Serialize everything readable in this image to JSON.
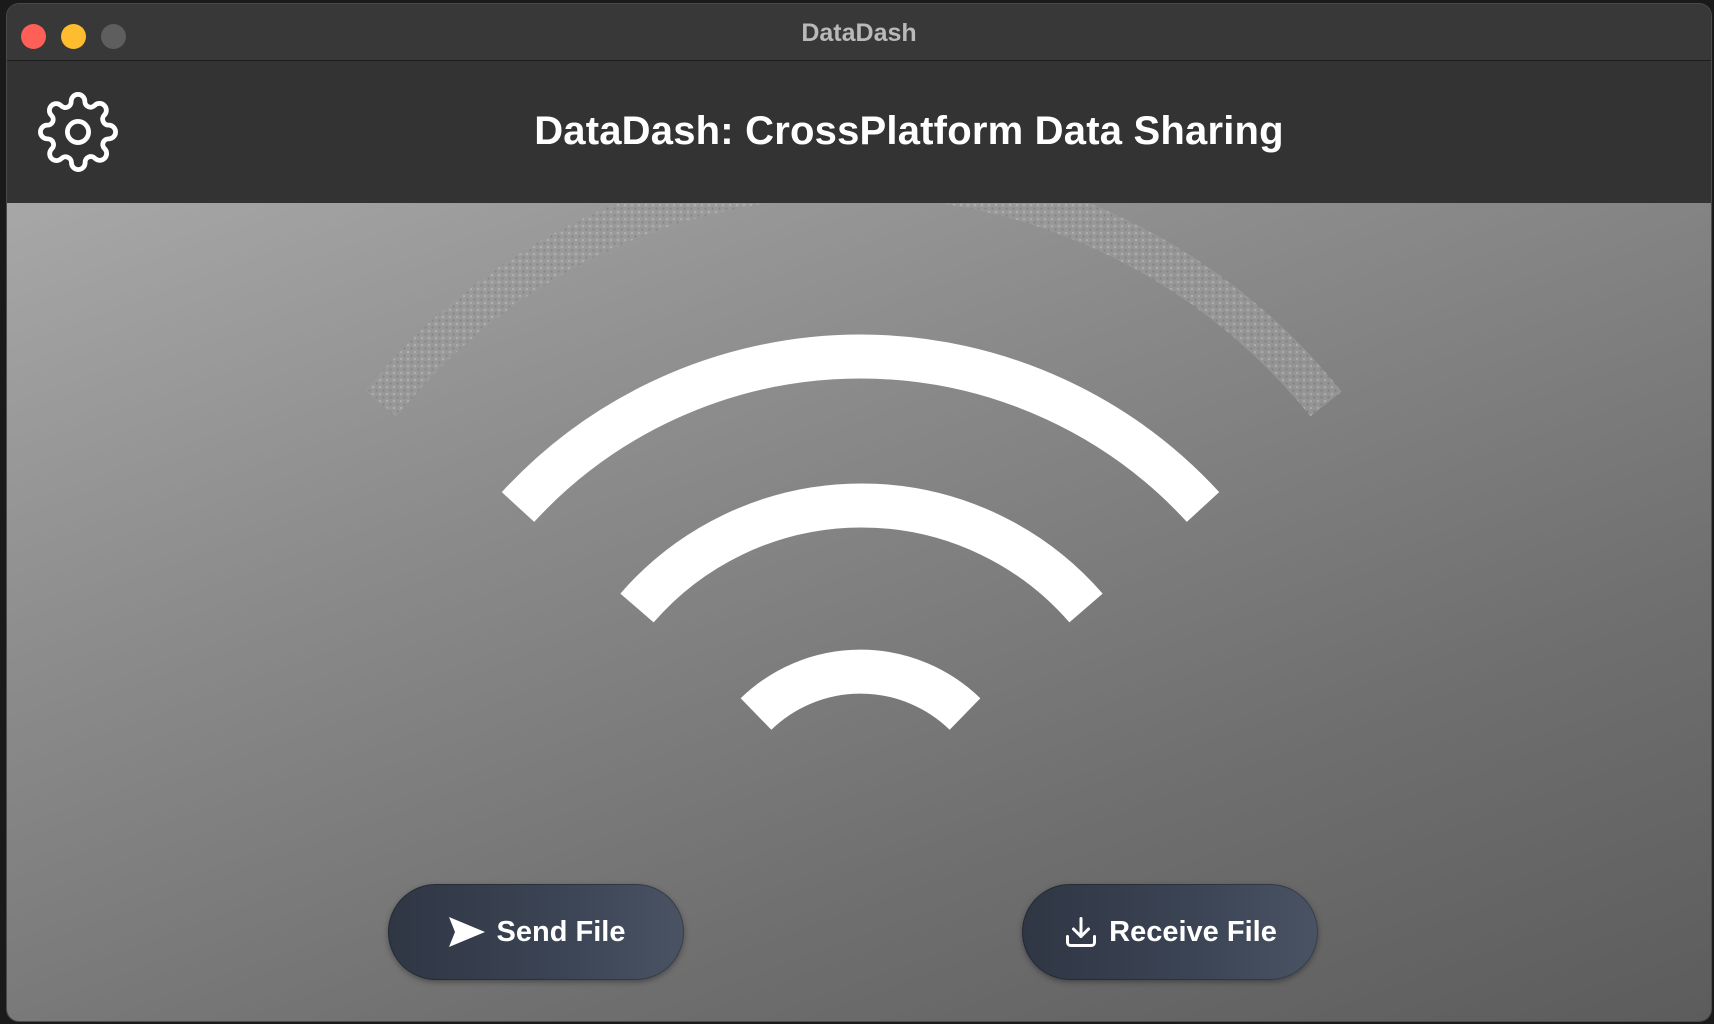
{
  "window": {
    "title": "DataDash"
  },
  "header": {
    "title": "DataDash: CrossPlatform Data Sharing",
    "settings_icon": "gear-icon"
  },
  "main": {
    "graphic_icon": "wifi-signal-icon",
    "send_button": {
      "label": "Send File",
      "icon": "send-icon"
    },
    "receive_button": {
      "label": "Receive File",
      "icon": "download-icon"
    }
  },
  "colors": {
    "close": "#fe5f57",
    "minimize": "#febc2e",
    "zoom": "#5e5e5e",
    "header_bg": "#333333",
    "button_bg": "#3a4352",
    "wave": "#ffffff"
  }
}
